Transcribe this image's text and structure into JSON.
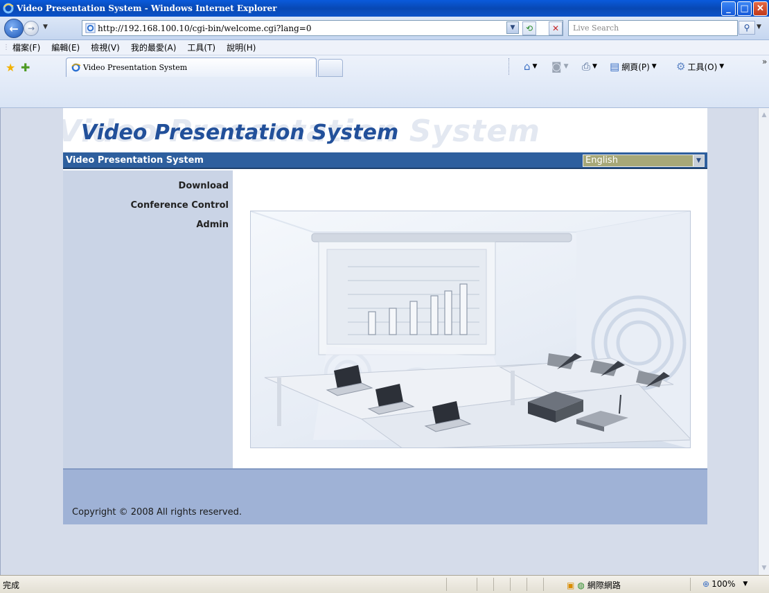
{
  "window": {
    "title": "Video Presentation System - Windows Internet Explorer"
  },
  "address_bar": {
    "url": "http://192.168.100.10/cgi-bin/welcome.cgi?lang=0",
    "search_placeholder": "Live Search"
  },
  "menu_bar": {
    "items": [
      "檔案(F)",
      "編輯(E)",
      "檢視(V)",
      "我的最愛(A)",
      "工具(T)",
      "說明(H)"
    ]
  },
  "tabs": [
    {
      "label": "Video Presentation System",
      "active": true
    }
  ],
  "command_bar": {
    "page_label": "網頁(P)",
    "tools_label": "工具(O)"
  },
  "page": {
    "banner_ghost": "Video Presentation System",
    "banner_title": "Video Presentation System",
    "nav_title": "Video Presentation System",
    "language_selected": "English",
    "menu": [
      "Download",
      "Conference Control",
      "Admin"
    ],
    "copyright": "Copyright © 2008 All rights reserved.",
    "colors": {
      "nav_strip": "#2e5f9e",
      "title_blue": "#22509a",
      "sidebar": "#cad4e6",
      "footer": "#9fb2d6",
      "language_select": "#a7a878"
    }
  },
  "status_bar": {
    "status": "完成",
    "zone": "網際網路",
    "zoom": "100%"
  }
}
